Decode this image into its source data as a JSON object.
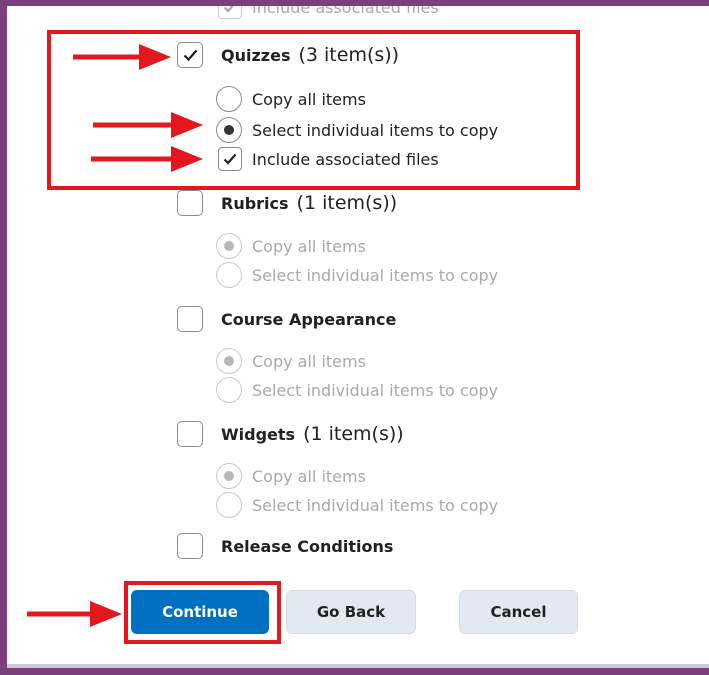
{
  "sections": {
    "prev_option": "Include associated files",
    "quizzes": {
      "title": "Quizzes",
      "count": "(3 item(s))",
      "copy_all": "Copy all items",
      "select_individual": "Select individual items to copy",
      "include_files": "Include associated files",
      "checked": true,
      "selected_option": "select_individual",
      "include_files_checked": true
    },
    "rubrics": {
      "title": "Rubrics",
      "count": "(1 item(s))",
      "copy_all": "Copy all items",
      "select_individual": "Select individual items to copy",
      "checked": false,
      "selected_option": "copy_all"
    },
    "course_appearance": {
      "title": "Course Appearance",
      "copy_all": "Copy all items",
      "select_individual": "Select individual items to copy",
      "checked": false,
      "selected_option": "copy_all"
    },
    "widgets": {
      "title": "Widgets",
      "count": "(1 item(s))",
      "copy_all": "Copy all items",
      "select_individual": "Select individual items to copy",
      "checked": false,
      "selected_option": "copy_all"
    },
    "release_conditions": {
      "title": "Release Conditions",
      "checked": false
    }
  },
  "buttons": {
    "continue": "Continue",
    "go_back": "Go Back",
    "cancel": "Cancel"
  },
  "colors": {
    "frame": "#7a3f7c",
    "primary": "#006fbf",
    "secondary": "#e3e9f1",
    "highlight": "#e3171e"
  }
}
